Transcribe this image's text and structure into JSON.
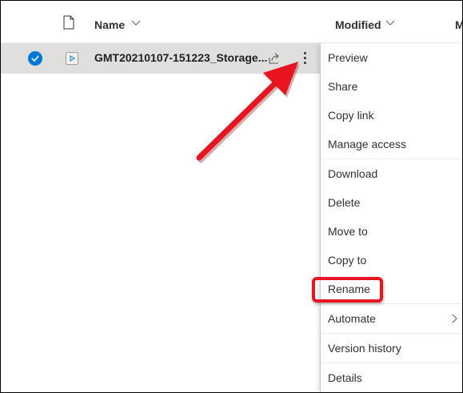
{
  "header": {
    "name_label": "Name",
    "modified_label": "Modified",
    "next_column_label_cut": "M"
  },
  "file_row": {
    "name": "GMT20210107-151223_Storage...",
    "selected": true,
    "file_type_icon": "video-file-icon"
  },
  "context_menu": {
    "items": [
      {
        "label": "Preview"
      },
      {
        "label": "Share"
      },
      {
        "label": "Copy link"
      },
      {
        "label": "Manage access"
      },
      {
        "label": "Download"
      },
      {
        "label": "Delete"
      },
      {
        "label": "Move to"
      },
      {
        "label": "Copy to"
      },
      {
        "label": "Rename"
      },
      {
        "label": "Automate"
      },
      {
        "label": "Version history"
      },
      {
        "label": "Details"
      }
    ]
  },
  "colors": {
    "accent": "#0078d4",
    "selected_row": "#e1dfdd",
    "annotation": "#e8141f"
  }
}
